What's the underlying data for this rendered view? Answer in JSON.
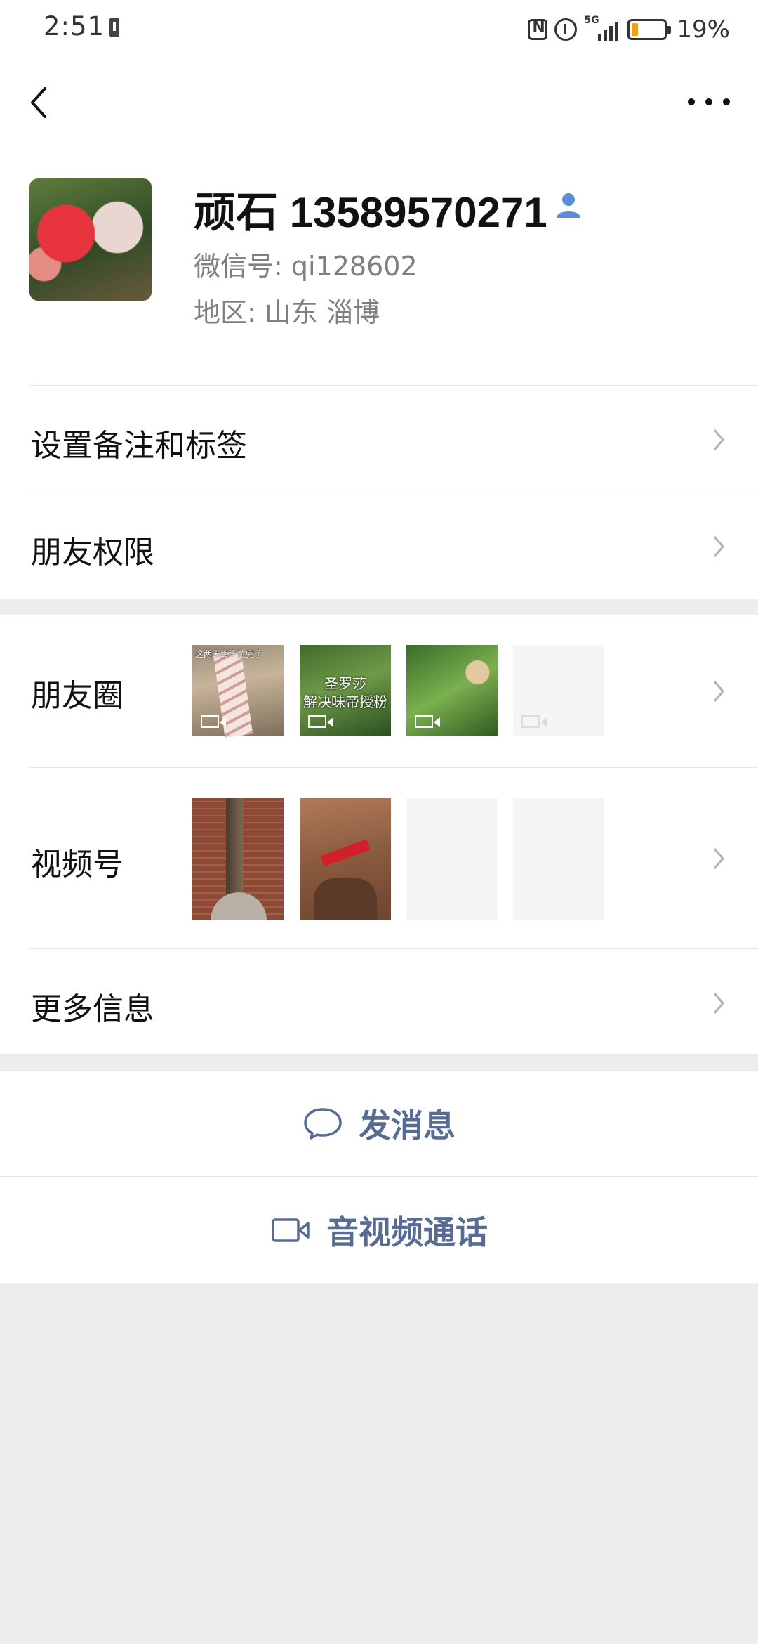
{
  "status_bar": {
    "time": "2:51",
    "network": "5G",
    "battery": "19%"
  },
  "profile": {
    "name": "顽石 13589570271",
    "wechat_id": "微信号: qi128602",
    "region": "地区: 山东  淄博"
  },
  "menu": {
    "remark_tags": "设置备注和标签",
    "friend_permissions": "朋友权限",
    "moments": "朋友圈",
    "channels": "视频号",
    "more_info": "更多信息"
  },
  "moments_thumbs": [
    {
      "caption": "这两天终于忙完了"
    },
    {
      "caption": "圣罗莎\n解决味帝授粉"
    },
    {
      "caption": ""
    },
    {
      "caption": ""
    }
  ],
  "actions": {
    "send_message": "发消息",
    "av_call": "音视频通话"
  },
  "colors": {
    "link_blue": "#576b95",
    "background": "#ededed",
    "battery_low": "#f0a020"
  }
}
